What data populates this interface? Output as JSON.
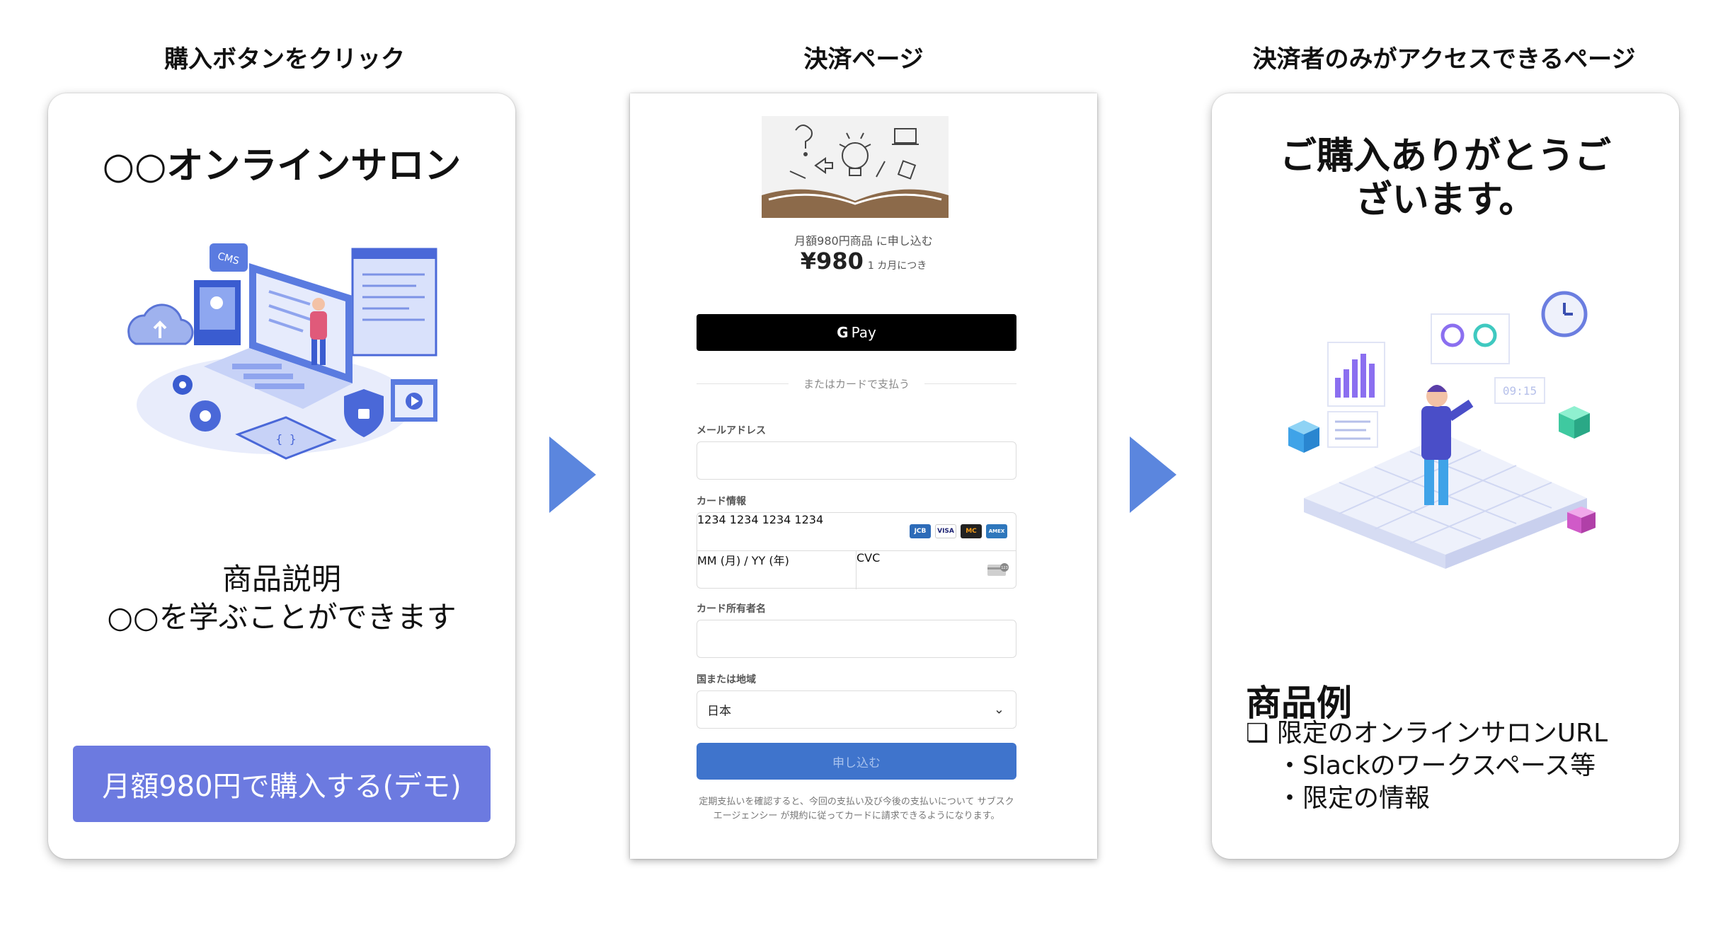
{
  "steps": [
    {
      "title": "購入ボタンをクリック"
    },
    {
      "title": "決済ページ"
    },
    {
      "title": "決済者のみがアクセスできるページ"
    }
  ],
  "colors": {
    "arrow": "#5b86de",
    "buy_button": "#6c7ae0",
    "submit_button": "#3f74cc"
  },
  "salon": {
    "title": "○○オンラインサロン",
    "desc_heading": "商品説明",
    "desc_body": "○○を学ぶことができます",
    "buy_button": "月額980円で購入する(デモ)"
  },
  "checkout": {
    "product": "月額980円商品 に申し込む",
    "price": "¥980",
    "period": "1 カ月につき",
    "gpay_label": "Pay",
    "gpay_g": "G",
    "divider": "またはカードで支払う",
    "email_label": "メールアドレス",
    "card_label": "カード情報",
    "card_number_placeholder": "1234 1234 1234 1234",
    "expiry_placeholder": "MM (月) / YY (年)",
    "cvc_placeholder": "CVC",
    "card_brands": [
      "JCB",
      "VISA",
      "MC",
      "AMEX"
    ],
    "holder_label": "カード所有者名",
    "country_label": "国または地域",
    "country_value": "日本",
    "submit": "申し込む",
    "terms": "定期支払いを確認すると、今回の支払い及び今後の支払いについて サブスクエージェンシー が規約に従ってカードに請求できるようになります。"
  },
  "thanks": {
    "title_line1": "ご購入ありがとうご",
    "title_line2": "ざいます。",
    "examples_title": "商品例",
    "item1": "❏ 限定のオンラインサロンURL",
    "item2": "・Slackのワークスペース等",
    "item3": "・限定の情報"
  }
}
